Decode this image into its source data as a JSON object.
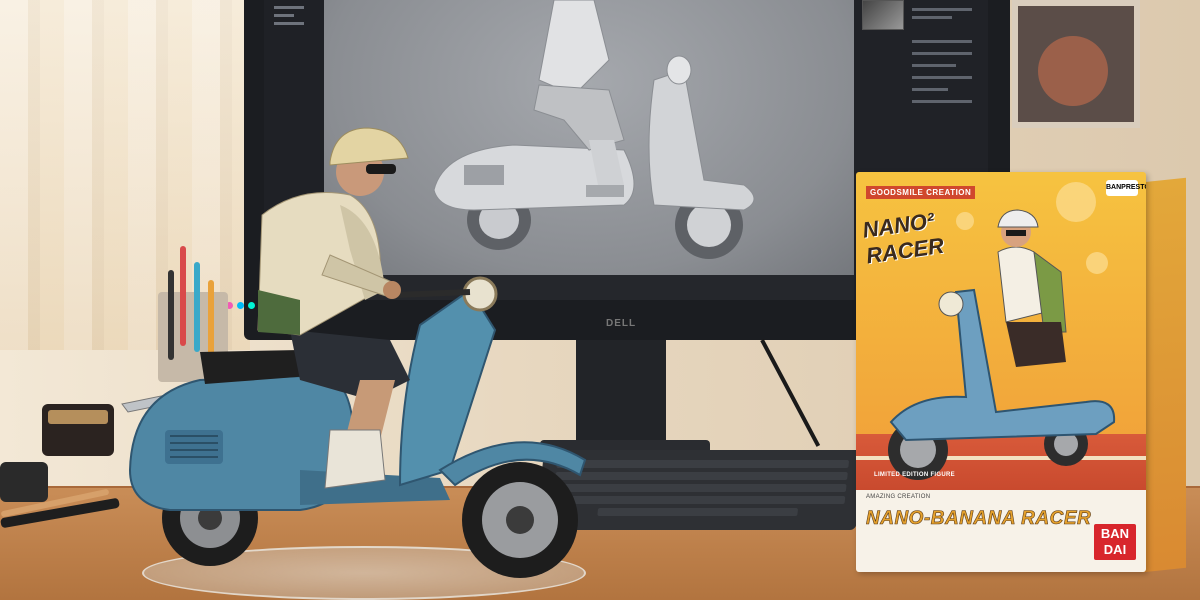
{
  "box": {
    "top_label": "GOODSMILE CREATION",
    "brand_corner": "BANPRESTO",
    "title": "NANO² RACER",
    "subtitle": "LIMITED EDITION FIGURE",
    "small_line": "AMAZING CREATION",
    "name": "NANO-BANANA RACER",
    "maker": "BAN DAI"
  },
  "monitor": {
    "brand": "DELL"
  },
  "colors": {
    "scooter": "#4f87a4",
    "box": "#f2a93b",
    "desk": "#c98d57"
  }
}
